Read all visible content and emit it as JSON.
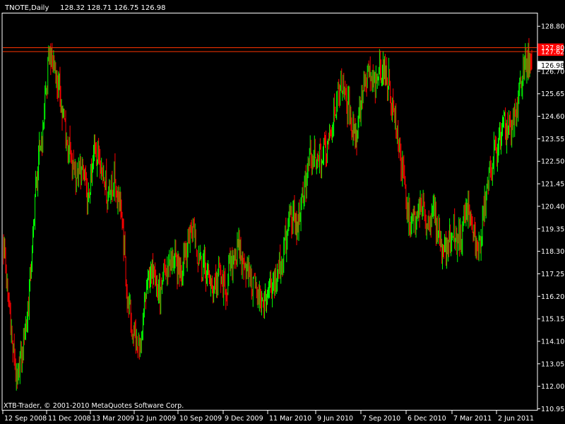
{
  "header": {
    "symbol": "TNOTE,Daily",
    "ohlc": "128.32 128.71 126.75 126.98"
  },
  "footer": {
    "copyright": "XTB-Trader, © 2001-2010 MetaQuotes Software Corp."
  },
  "colors": {
    "background": "#000000",
    "bull": "#00ff00",
    "bear": "#ff0000",
    "frame": "#ffffff",
    "level_line": "#ff3300",
    "level_box": "#ff0000",
    "price_box": "#ffffff",
    "price_box_text": "#000000"
  },
  "chart_data": {
    "type": "candlestick",
    "title": "TNOTE,Daily",
    "ylim": [
      110.9,
      129.4
    ],
    "y_ticks": [
      "128.80",
      "126.70",
      "125.65",
      "124.60",
      "123.55",
      "122.50",
      "121.45",
      "120.40",
      "119.35",
      "118.30",
      "117.25",
      "116.20",
      "115.15",
      "114.10",
      "113.05",
      "112.00",
      "110.95"
    ],
    "x_ticks": [
      "12 Sep 2008",
      "11 Dec 2008",
      "13 Mar 2009",
      "12 Jun 2009",
      "10 Sep 2009",
      "9 Dec 2009",
      "11 Mar 2010",
      "9 Jun 2010",
      "7 Sep 2010",
      "6 Dec 2010",
      "7 Mar 2011",
      "2 Jun 2011"
    ],
    "current_price": "126.98",
    "levels": [
      "127.80",
      "127.62"
    ],
    "series": [
      {
        "t": "12 Sep 2008",
        "close": 118.5
      },
      {
        "t": "1 Oct 2008",
        "close": 115.3
      },
      {
        "t": "15 Oct 2008",
        "close": 112.1
      },
      {
        "t": "24 Oct 2008",
        "close": 113.8
      },
      {
        "t": "5 Nov 2008",
        "close": 116.5
      },
      {
        "t": "18 Nov 2008",
        "close": 121.5
      },
      {
        "t": "27 Nov 2008",
        "close": 124.0
      },
      {
        "t": "5 Dec 2008",
        "close": 127.5
      },
      {
        "t": "11 Dec 2008",
        "close": 126.8
      },
      {
        "t": "23 Dec 2008",
        "close": 124.8
      },
      {
        "t": "9 Jan 2009",
        "close": 123.0
      },
      {
        "t": "26 Jan 2009",
        "close": 121.8
      },
      {
        "t": "10 Feb 2009",
        "close": 122.2
      },
      {
        "t": "25 Feb 2009",
        "close": 120.5
      },
      {
        "t": "13 Mar 2009",
        "close": 123.2
      },
      {
        "t": "26 Mar 2009",
        "close": 122.4
      },
      {
        "t": "9 Apr 2009",
        "close": 121.0
      },
      {
        "t": "24 Apr 2009",
        "close": 121.6
      },
      {
        "t": "8 May 2009",
        "close": 120.5
      },
      {
        "t": "20 May 2009",
        "close": 116.0
      },
      {
        "t": "2 Jun 2009",
        "close": 114.4
      },
      {
        "t": "12 Jun 2009",
        "close": 113.4
      },
      {
        "t": "23 Jun 2009",
        "close": 116.8
      },
      {
        "t": "8 Jul 2009",
        "close": 117.6
      },
      {
        "t": "22 Jul 2009",
        "close": 116.1
      },
      {
        "t": "5 Aug 2009",
        "close": 117.5
      },
      {
        "t": "19 Aug 2009",
        "close": 118.0
      },
      {
        "t": "2 Sep 2009",
        "close": 117.2
      },
      {
        "t": "10 Sep 2009",
        "close": 118.6
      },
      {
        "t": "24 Sep 2009",
        "close": 119.4
      },
      {
        "t": "8 Oct 2009",
        "close": 118.0
      },
      {
        "t": "22 Oct 2009",
        "close": 117.4
      },
      {
        "t": "5 Nov 2009",
        "close": 116.5
      },
      {
        "t": "19 Nov 2009",
        "close": 117.2
      },
      {
        "t": "2 Dec 2009",
        "close": 116.3
      },
      {
        "t": "9 Dec 2009",
        "close": 117.8
      },
      {
        "t": "23 Dec 2009",
        "close": 118.5
      },
      {
        "t": "8 Jan 2010",
        "close": 117.6
      },
      {
        "t": "22 Jan 2010",
        "close": 117.0
      },
      {
        "t": "5 Feb 2010",
        "close": 116.4
      },
      {
        "t": "19 Feb 2010",
        "close": 115.8
      },
      {
        "t": "2 Mar 2010",
        "close": 116.5
      },
      {
        "t": "11 Mar 2010",
        "close": 117.1
      },
      {
        "t": "25 Mar 2010",
        "close": 118.3
      },
      {
        "t": "8 Apr 2010",
        "close": 120.0
      },
      {
        "t": "22 Apr 2010",
        "close": 119.4
      },
      {
        "t": "6 May 2010",
        "close": 121.0
      },
      {
        "t": "20 May 2010",
        "close": 122.6
      },
      {
        "t": "2 Jun 2010",
        "close": 122.4
      },
      {
        "t": "9 Jun 2010",
        "close": 122.8
      },
      {
        "t": "23 Jun 2010",
        "close": 123.8
      },
      {
        "t": "8 Jul 2010",
        "close": 125.2
      },
      {
        "t": "22 Jul 2010",
        "close": 126.2
      },
      {
        "t": "5 Aug 2010",
        "close": 124.8
      },
      {
        "t": "19 Aug 2010",
        "close": 123.6
      },
      {
        "t": "2 Sep 2010",
        "close": 125.8
      },
      {
        "t": "7 Sep 2010",
        "close": 126.5
      },
      {
        "t": "21 Sep 2010",
        "close": 126.0
      },
      {
        "t": "5 Oct 2010",
        "close": 127.0
      },
      {
        "t": "19 Oct 2010",
        "close": 126.3
      },
      {
        "t": "2 Nov 2010",
        "close": 124.5
      },
      {
        "t": "16 Nov 2010",
        "close": 122.5
      },
      {
        "t": "30 Nov 2010",
        "close": 120.0
      },
      {
        "t": "6 Dec 2010",
        "close": 119.6
      },
      {
        "t": "20 Dec 2010",
        "close": 120.4
      },
      {
        "t": "5 Jan 2011",
        "close": 119.6
      },
      {
        "t": "19 Jan 2011",
        "close": 120.2
      },
      {
        "t": "2 Feb 2011",
        "close": 118.6
      },
      {
        "t": "16 Feb 2011",
        "close": 118.5
      },
      {
        "t": "28 Feb 2011",
        "close": 119.2
      },
      {
        "t": "7 Mar 2011",
        "close": 118.8
      },
      {
        "t": "21 Mar 2011",
        "close": 120.5
      },
      {
        "t": "4 Apr 2011",
        "close": 119.0
      },
      {
        "t": "18 Apr 2011",
        "close": 118.4
      },
      {
        "t": "2 May 2011",
        "close": 121.0
      },
      {
        "t": "16 May 2011",
        "close": 122.6
      },
      {
        "t": "2 Jun 2011",
        "close": 123.4
      },
      {
        "t": "16 Jun 2011",
        "close": 124.2
      },
      {
        "t": "30 Jun 2011",
        "close": 123.8
      },
      {
        "t": "14 Jul 2011",
        "close": 125.5
      },
      {
        "t": "28 Jul 2011",
        "close": 127.3
      },
      {
        "t": "4 Aug 2011",
        "close": 126.98
      }
    ]
  }
}
